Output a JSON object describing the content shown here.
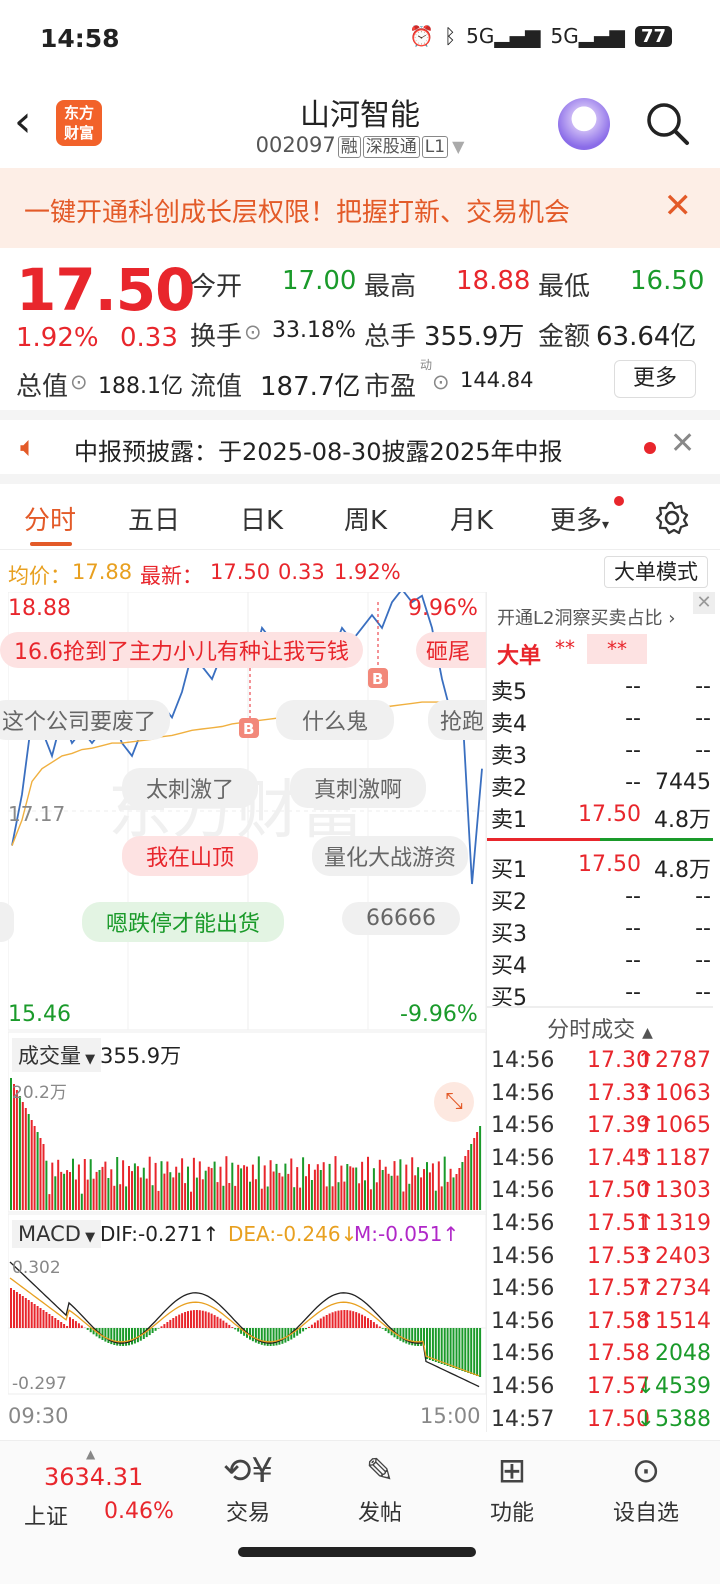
{
  "status": {
    "time": "14:58",
    "battery": "77",
    "signal1": "5G",
    "signal2": "5G"
  },
  "header": {
    "title": "山河智能",
    "code": "002097",
    "tag_margin": "融",
    "tag_connect": "深股通",
    "tag_level": "L1",
    "logo_line1": "东方",
    "logo_line2": "财富"
  },
  "banner": {
    "text": "一键开通科创成长层权限！把握打新、交易机会"
  },
  "quote": {
    "price": "17.50",
    "pct": "1.92%",
    "change": "0.33",
    "open_label": "今开",
    "open": "17.00",
    "high_label": "最高",
    "high": "18.88",
    "low_label": "最低",
    "low": "16.50",
    "turnover_label": "换手",
    "turnover": "33.18%",
    "volume_label": "总手",
    "volume": "355.9万",
    "amount_label": "金额",
    "amount": "63.64亿",
    "mktcap_label": "总值",
    "mktcap": "188.1亿",
    "float_label": "流值",
    "float": "187.7亿",
    "pe_label": "市盈",
    "pe_sup": "动",
    "pe": "144.84",
    "more": "更多"
  },
  "notice": {
    "text": "中报预披露：于2025-08-30披露2025年中报"
  },
  "tabs": [
    "分时",
    "五日",
    "日K",
    "周K",
    "月K",
    "更多"
  ],
  "pricebar": {
    "avg_label": "均价：",
    "avg": "17.88",
    "latest_label": "最新：",
    "latest": "17.50",
    "chg": "0.33",
    "pct": "1.92%",
    "mode": "大单模式"
  },
  "chart": {
    "top_price": "18.88",
    "top_pct": "9.96%",
    "mid_price": "17.17",
    "bottom_price": "15.46",
    "bottom_pct": "-9.96%",
    "vol_label": "成交量",
    "vol_total": "355.9万",
    "vol_max": "20.2万",
    "macd_label": "MACD",
    "dif": "DIF:-0.271↑",
    "dea": "DEA:-0.246↓",
    "m": "M:-0.051↑",
    "macd_max": "0.302",
    "macd_min": "-0.297",
    "time_start": "09:30",
    "time_end": "15:00",
    "watermark": "东方财富",
    "danmaku": [
      {
        "text": "16.6抢到了主力小儿有种让我亏钱",
        "style": "pink"
      },
      {
        "text": "砸尾",
        "style": "pink"
      },
      {
        "text": "这个公司要废了",
        "style": "gray"
      },
      {
        "text": "什么鬼",
        "style": "gray"
      },
      {
        "text": "抢跑",
        "style": "gray"
      },
      {
        "text": "太刺激了",
        "style": "gray"
      },
      {
        "text": "真刺激啊",
        "style": "gray"
      },
      {
        "text": "我在山顶",
        "style": "pink"
      },
      {
        "text": "量化大战游资",
        "style": "gray"
      },
      {
        "text": "嗯跌停才能出货",
        "style": "green"
      },
      {
        "text": "66666",
        "style": "gray"
      }
    ],
    "marker_b": "B"
  },
  "chart_data": {
    "type": "line",
    "title": "",
    "xlabel": "",
    "ylabel": "",
    "x_range": [
      "09:30",
      "15:00"
    ],
    "ylim": [
      15.46,
      18.88
    ],
    "series": [
      {
        "values": [
          16.9,
          17.3,
          17.9,
          17.8,
          17.6,
          17.9,
          17.7,
          17.8,
          17.7,
          17.8,
          17.9,
          17.7,
          17.6,
          17.8,
          17.9,
          18.0,
          17.9,
          18.1,
          18.4,
          18.3,
          18.2,
          18.4,
          18.5,
          18.4,
          18.3,
          18.6,
          18.5,
          18.4,
          18.3,
          18.4,
          18.5,
          18.3,
          18.4,
          18.6,
          18.5,
          18.6,
          18.7,
          18.6,
          18.8,
          18.9,
          18.8,
          18.85,
          18.6,
          18.2,
          17.9,
          18.0,
          16.6,
          17.5
        ]
      },
      {
        "values": [
          16.9,
          17.1,
          17.4,
          17.5,
          17.55,
          17.6,
          17.62,
          17.65,
          17.66,
          17.68,
          17.7,
          17.7,
          17.71,
          17.72,
          17.73,
          17.75,
          17.76,
          17.78,
          17.8,
          17.81,
          17.82,
          17.83,
          17.85,
          17.86,
          17.87,
          17.88,
          17.89,
          17.9,
          17.9,
          17.91,
          17.92,
          17.92,
          17.93,
          17.94,
          17.95,
          17.96,
          17.97,
          17.98,
          17.99,
          18.0,
          18.01,
          18.02,
          18.02,
          18.02,
          18.01,
          18.0,
          17.95,
          17.88
        ]
      }
    ]
  },
  "orderbook": {
    "header": "开通L2洞察买卖占比",
    "dd_label": "大单",
    "dd_stars": "**",
    "dd_box": "**",
    "asks": [
      {
        "name": "卖5",
        "price": "--",
        "vol": "--"
      },
      {
        "name": "卖4",
        "price": "--",
        "vol": "--"
      },
      {
        "name": "卖3",
        "price": "--",
        "vol": "--"
      },
      {
        "name": "卖2",
        "price": "--",
        "vol": "7445"
      },
      {
        "name": "卖1",
        "price": "17.50",
        "vol": "4.8万"
      }
    ],
    "bids": [
      {
        "name": "买1",
        "price": "17.50",
        "vol": "4.8万"
      },
      {
        "name": "买2",
        "price": "--",
        "vol": "--"
      },
      {
        "name": "买3",
        "price": "--",
        "vol": "--"
      },
      {
        "name": "买4",
        "price": "--",
        "vol": "--"
      },
      {
        "name": "买5",
        "price": "--",
        "vol": "--"
      }
    ],
    "trades_title": "分时成交",
    "trades": [
      {
        "time": "14:56",
        "price": "17.30",
        "dir": "↑",
        "vol": "2787",
        "color": "red"
      },
      {
        "time": "14:56",
        "price": "17.33",
        "dir": "↑",
        "vol": "1063",
        "color": "red"
      },
      {
        "time": "14:56",
        "price": "17.39",
        "dir": "↑",
        "vol": "1065",
        "color": "red"
      },
      {
        "time": "14:56",
        "price": "17.45",
        "dir": "↑",
        "vol": "1187",
        "color": "red"
      },
      {
        "time": "14:56",
        "price": "17.50",
        "dir": "↑",
        "vol": "1303",
        "color": "red"
      },
      {
        "time": "14:56",
        "price": "17.51",
        "dir": "↑",
        "vol": "1319",
        "color": "red"
      },
      {
        "time": "14:56",
        "price": "17.53",
        "dir": "↑",
        "vol": "2403",
        "color": "red"
      },
      {
        "time": "14:56",
        "price": "17.57",
        "dir": "↑",
        "vol": "2734",
        "color": "red"
      },
      {
        "time": "14:56",
        "price": "17.58",
        "dir": "↑",
        "vol": "1514",
        "color": "red"
      },
      {
        "time": "14:56",
        "price": "17.58",
        "dir": "",
        "vol": "2048",
        "color": "green"
      },
      {
        "time": "14:56",
        "price": "17.57",
        "dir": "↓",
        "vol": "4539",
        "color": "green"
      },
      {
        "time": "14:57",
        "price": "17.50",
        "dir": "↓",
        "vol": "5388",
        "color": "green"
      }
    ]
  },
  "bottom": {
    "index_value": "3634.31",
    "index_name": "上证",
    "index_pct": "0.46%",
    "nav": [
      {
        "label": "交易",
        "icon": "trade-icon"
      },
      {
        "label": "发帖",
        "icon": "post-icon"
      },
      {
        "label": "功能",
        "icon": "function-icon"
      },
      {
        "label": "设自选",
        "icon": "favorite-icon"
      }
    ]
  },
  "colors": {
    "up": "#e8262c",
    "down": "#1a9a2a",
    "accent": "#e35a28",
    "price_line": "#3a6fc0",
    "avg_line": "#f0b040"
  }
}
